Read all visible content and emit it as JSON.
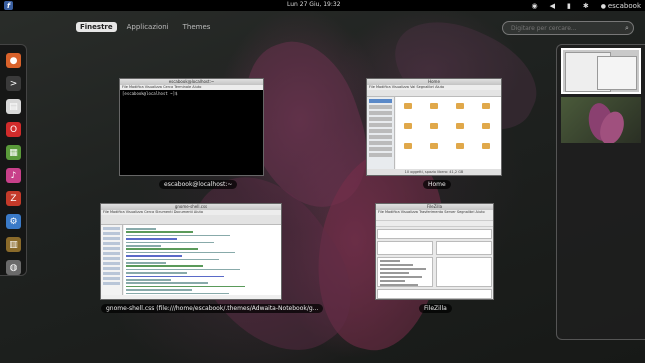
{
  "topbar": {
    "activities_icon_label": "f",
    "clock": "Lun 27 Giu, 19:32",
    "user": "escabook"
  },
  "view_tabs": [
    {
      "label": "Finestre",
      "active": true
    },
    {
      "label": "Applicazioni",
      "active": false
    },
    {
      "label": "Themes",
      "active": false
    }
  ],
  "search": {
    "placeholder": "Digitare per cercare..."
  },
  "dash": {
    "items": [
      {
        "name": "firefox-icon",
        "color": "#d9622b",
        "glyph": "●"
      },
      {
        "name": "terminal-icon",
        "color": "#3a3a3a",
        "glyph": ">"
      },
      {
        "name": "files-icon",
        "color": "#d8d8d8",
        "glyph": "▤"
      },
      {
        "name": "opera-icon",
        "color": "#d12b2b",
        "glyph": "O"
      },
      {
        "name": "image-viewer-icon",
        "color": "#5a9a3a",
        "glyph": "▦"
      },
      {
        "name": "music-player-icon",
        "color": "#c8408a",
        "glyph": "♪"
      },
      {
        "name": "filezilla-icon",
        "color": "#c43a2a",
        "glyph": "Z"
      },
      {
        "name": "settings-icon",
        "color": "#3a7ac8",
        "glyph": "⚙"
      },
      {
        "name": "system-monitor-icon",
        "color": "#8a6a2a",
        "glyph": "▥"
      },
      {
        "name": "drive-icon",
        "color": "#6a6a6a",
        "glyph": "◍"
      }
    ]
  },
  "windows": {
    "terminal": {
      "title": "escabook@localhost:~",
      "menu": "File  Modifica  Visualizza  Cerca  Terminale  Aiuto",
      "prompt": "[escabook@localhost ~]$ ",
      "caption": "escabook@localhost:~"
    },
    "files": {
      "title": "Home",
      "menu": "File  Modifica  Visualizza  Vai  Segnalibri  Aiuto",
      "status": "10 oggetti, spazio libero: 41,2 GB",
      "caption": "Home"
    },
    "gedit": {
      "title": "gnome-shell.css",
      "menu": "File  Modifica  Visualizza  Cerca  Strumenti  Documenti  Aiuto",
      "caption": "gnome-shell.css (file:///home/escabook/.themes/Adwaita-Notebook/g..."
    },
    "filezilla": {
      "title": "FileZilla",
      "menu": "File  Modifica  Visualizza  Trasferimento  Server  Segnalibri  Aiuto",
      "caption": "FileZilla"
    }
  }
}
